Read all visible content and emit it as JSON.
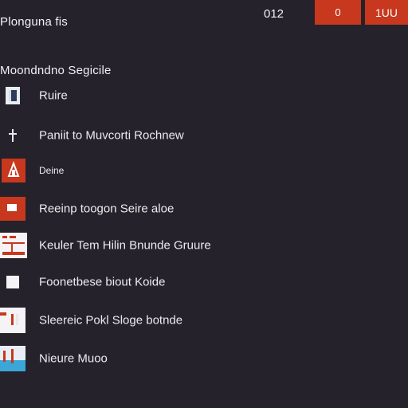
{
  "header": {
    "title": "Plonguna fis",
    "count": "012",
    "button_1_label": "0",
    "button_2_label": "1UU"
  },
  "section": {
    "title": "Moondndno Segicile"
  },
  "items": [
    {
      "label": "Ruire",
      "icon": "document-icon"
    },
    {
      "label": "Paniit to Muvcorti Rochnew",
      "icon": "pin-icon"
    },
    {
      "label": "Deine",
      "icon": "building-icon"
    },
    {
      "label": "Reeinp toogon Seire aloe",
      "icon": "window-icon"
    },
    {
      "label": "Keuler Tem Hilin Bnunde Gruure",
      "icon": "calendar-icon"
    },
    {
      "label": "Foonetbese biout Koide",
      "icon": "square-icon"
    },
    {
      "label": "Sleereic Pokl Sloge botnde",
      "icon": "clipboard-icon"
    },
    {
      "label": "Nieure Muoo",
      "icon": "image-icon"
    }
  ],
  "colors": {
    "background": "#25222b",
    "accent": "#c7381e",
    "text": "#ededef"
  }
}
